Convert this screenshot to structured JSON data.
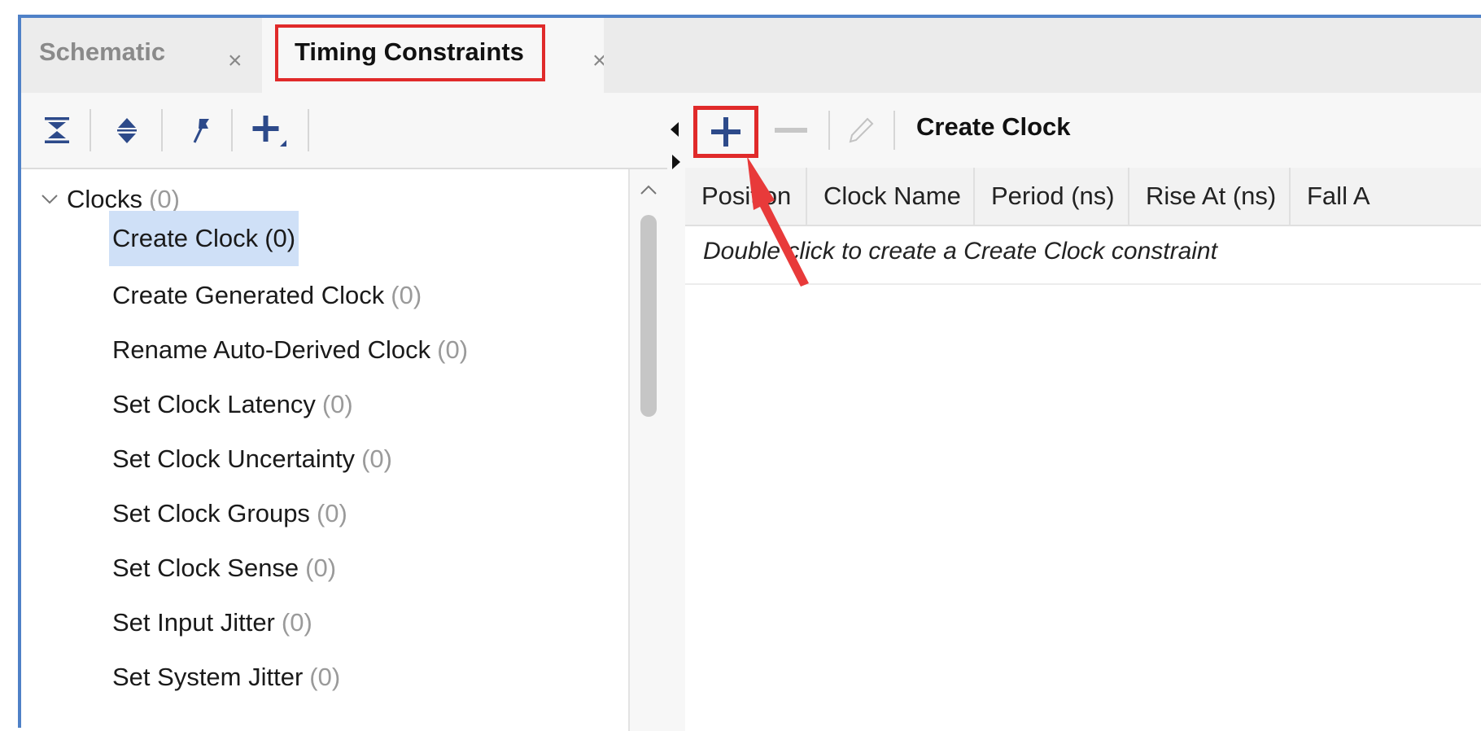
{
  "tabs": [
    {
      "label": "Schematic",
      "active": false
    },
    {
      "label": "Timing Constraints",
      "active": true
    }
  ],
  "close_symbol": "×",
  "left_toolbar": {
    "icons": [
      "collapse-all-icon",
      "expand-all-icon",
      "pin-icon",
      "add-menu-icon"
    ]
  },
  "tree": {
    "root": {
      "label": "Clocks",
      "count": "(0)",
      "expanded": true
    },
    "items": [
      {
        "label": "Create Clock",
        "count": "(0)",
        "selected": true
      },
      {
        "label": "Create Generated Clock",
        "count": "(0)"
      },
      {
        "label": "Rename Auto-Derived Clock",
        "count": "(0)"
      },
      {
        "label": "Set Clock Latency",
        "count": "(0)"
      },
      {
        "label": "Set Clock Uncertainty",
        "count": "(0)"
      },
      {
        "label": "Set Clock Groups",
        "count": "(0)"
      },
      {
        "label": "Set Clock Sense",
        "count": "(0)"
      },
      {
        "label": "Set Input Jitter",
        "count": "(0)"
      },
      {
        "label": "Set System Jitter",
        "count": "(0)"
      }
    ]
  },
  "right_toolbar": {
    "icons": [
      "add-icon",
      "remove-icon",
      "edit-icon"
    ],
    "title": "Create Clock"
  },
  "table": {
    "columns": [
      "Position",
      "Clock Name",
      "Period (ns)",
      "Rise At (ns)",
      "Fall A"
    ],
    "hint": "Double click to create a Create Clock constraint"
  },
  "colors": {
    "highlight": "#e02a2a",
    "selection": "#cfe0f7",
    "frame": "#4f81c7",
    "icon_blue": "#2d4a8a"
  }
}
